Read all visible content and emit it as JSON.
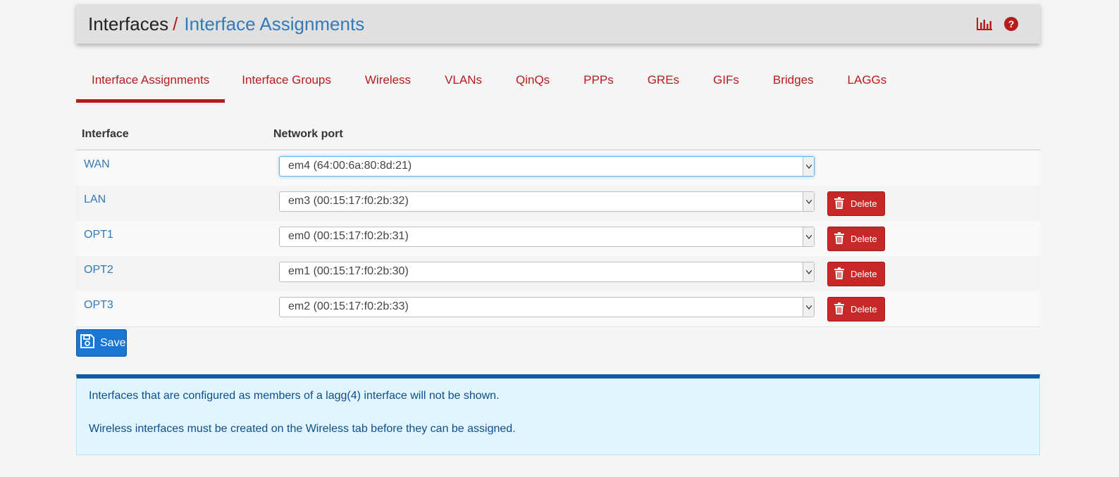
{
  "header": {
    "breadcrumb_root": "Interfaces",
    "breadcrumb_sep": "/",
    "breadcrumb_current": "Interface Assignments",
    "icons": [
      "bar-chart-icon",
      "help-icon"
    ]
  },
  "tabs": [
    {
      "label": "Interface Assignments",
      "active": true
    },
    {
      "label": "Interface Groups"
    },
    {
      "label": "Wireless"
    },
    {
      "label": "VLANs"
    },
    {
      "label": "QinQs"
    },
    {
      "label": "PPPs"
    },
    {
      "label": "GREs"
    },
    {
      "label": "GIFs"
    },
    {
      "label": "Bridges"
    },
    {
      "label": "LAGGs"
    }
  ],
  "table": {
    "headers": {
      "interface": "Interface",
      "port": "Network port"
    },
    "rows": [
      {
        "name": "WAN",
        "port": "em4 (64:00:6a:80:8d:21)",
        "deletable": false
      },
      {
        "name": "LAN",
        "port": "em3 (00:15:17:f0:2b:32)",
        "deletable": true
      },
      {
        "name": "OPT1",
        "port": "em0 (00:15:17:f0:2b:31)",
        "deletable": true
      },
      {
        "name": "OPT2",
        "port": "em1 (00:15:17:f0:2b:30)",
        "deletable": true
      },
      {
        "name": "OPT3",
        "port": "em2 (00:15:17:f0:2b:33)",
        "deletable": true
      }
    ],
    "delete_label": "Delete"
  },
  "save_label": "Save",
  "info": {
    "line1": "Interfaces that are configured as members of a lagg(4) interface will not be shown.",
    "line2": "Wireless interfaces must be created on the Wireless tab before they can be assigned."
  },
  "colors": {
    "accent_red": "#b71c1c",
    "link_blue": "#337ab7",
    "primary_blue": "#1976d2",
    "info_bg": "#e1f5fe"
  }
}
